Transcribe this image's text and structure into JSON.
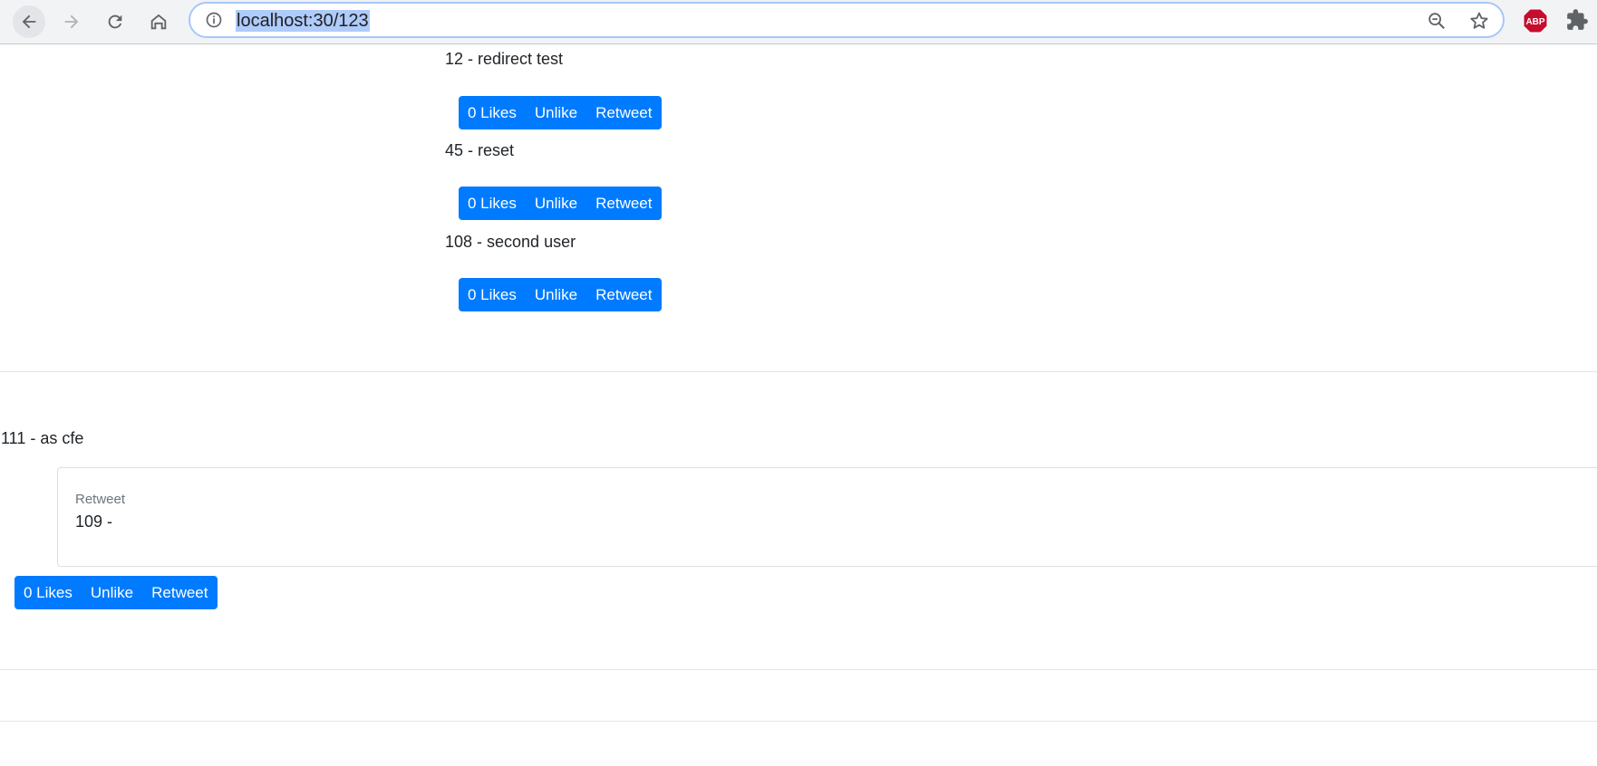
{
  "browser": {
    "url": "localhost:30/123",
    "icons": {
      "back": "arrow-left-icon",
      "forward": "arrow-right-icon",
      "reload": "reload-icon",
      "home": "home-icon",
      "info": "info-icon",
      "zoom": "zoom-out-icon",
      "bookmark": "star-icon",
      "adblock": "abp-icon",
      "extensions": "puzzle-icon"
    },
    "adblock_label": "ABP"
  },
  "tweets": [
    {
      "text": "12 - redirect test",
      "buttons": {
        "likes": "0 Likes",
        "unlike": "Unlike",
        "retweet": "Retweet"
      }
    },
    {
      "text": "45 - reset",
      "buttons": {
        "likes": "0 Likes",
        "unlike": "Unlike",
        "retweet": "Retweet"
      }
    },
    {
      "text": "108 - second user",
      "buttons": {
        "likes": "0 Likes",
        "unlike": "Unlike",
        "retweet": "Retweet"
      }
    },
    {
      "text": "111 - as cfe",
      "retweet": {
        "label": "Retweet",
        "text": "109 -"
      },
      "buttons": {
        "likes": "0 Likes",
        "unlike": "Unlike",
        "retweet": "Retweet"
      }
    }
  ],
  "colors": {
    "primary": "#007bff",
    "muted": "#6c757d",
    "url_highlight": "#aecbfa"
  }
}
